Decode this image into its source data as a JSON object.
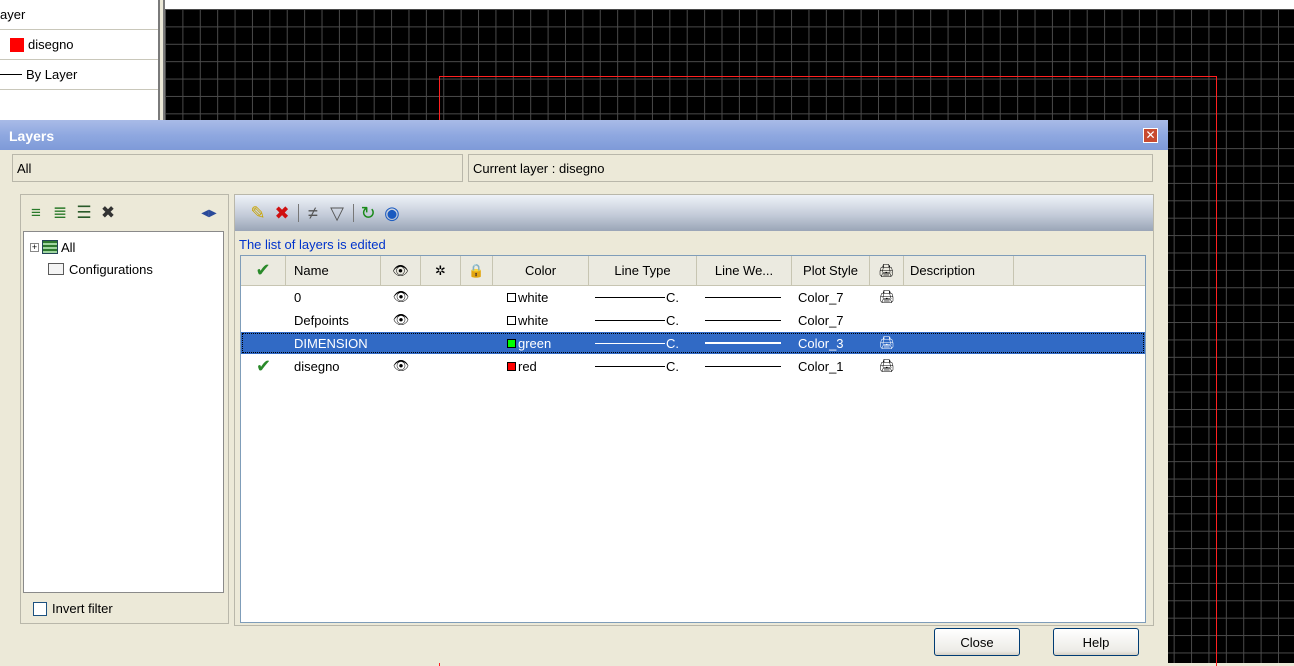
{
  "properties_panel": {
    "layer_row": "ayer",
    "layer_name": "disegno",
    "linetype": "By Layer"
  },
  "dialog": {
    "title": "Layers",
    "filter_text": "All",
    "current_layer": "Current layer : disegno",
    "status_message": "The list of layers is edited",
    "invert_filter_label": "Invert filter",
    "close_button": "Close",
    "help_button": "Help"
  },
  "tree": {
    "items": [
      {
        "label": "All",
        "expander": "+"
      },
      {
        "label": "Configurations"
      }
    ]
  },
  "columns": {
    "name": "Name",
    "color": "Color",
    "linetype": "Line Type",
    "lineweight": "Line We...",
    "plotstyle": "Plot Style",
    "description": "Description"
  },
  "layers": [
    {
      "name": "0",
      "on": "👁",
      "color": "white",
      "color_hex": "#ffffff",
      "linetype": "C.",
      "plotstyle": "Color_7",
      "plot": "🖨",
      "current": false,
      "selected": false
    },
    {
      "name": "Defpoints",
      "on": "👁",
      "color": "white",
      "color_hex": "#ffffff",
      "linetype": "C.",
      "plotstyle": "Color_7",
      "plot": "",
      "current": false,
      "selected": false
    },
    {
      "name": "DIMENSION",
      "on": "",
      "color": "green",
      "color_hex": "#00ff00",
      "linetype": "C.",
      "plotstyle": "Color_3",
      "plot": "🖨",
      "current": false,
      "selected": true
    },
    {
      "name": "disegno",
      "on": "👁",
      "color": "red",
      "color_hex": "#ff0000",
      "linetype": "C.",
      "plotstyle": "Color_1",
      "plot": "🖨",
      "current": true,
      "selected": false
    }
  ],
  "icons": {
    "check": "✔",
    "eye": "👁",
    "freeze": "✲",
    "lock": "🔒",
    "printer": "🖨",
    "close": "✕",
    "collapse": "◀▶"
  },
  "colors": {
    "accent_selection": "#316ac5",
    "title_gradient": "#8fa8e0",
    "canvas_bg": "#000000",
    "rect_border": "#ff2020"
  }
}
